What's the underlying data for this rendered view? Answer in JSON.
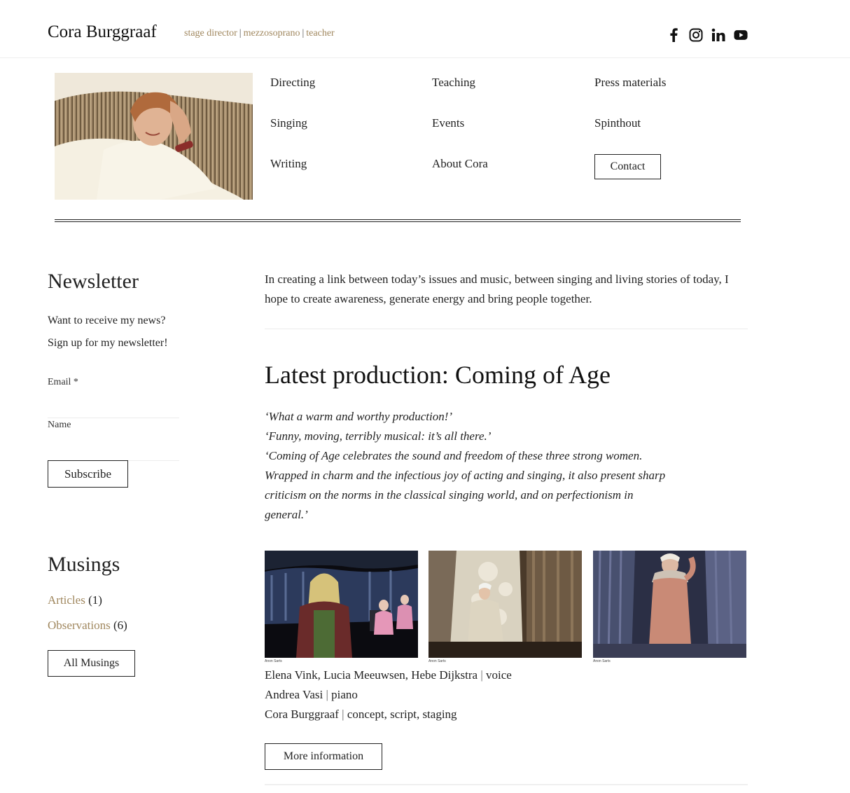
{
  "header": {
    "site_name": "Cora Burggraaf",
    "tagline": [
      "stage director",
      "mezzosoprano",
      "teacher"
    ],
    "tagline_sep": "|",
    "social_icons": [
      "facebook-icon",
      "instagram-icon",
      "linkedin-icon",
      "youtube-icon"
    ]
  },
  "nav": {
    "items": [
      "Directing",
      "Teaching",
      "Press materials",
      "Singing",
      "Events",
      "Spinthout",
      "Writing",
      "About Cora"
    ],
    "contact_label": "Contact"
  },
  "newsletter": {
    "title": "Newsletter",
    "line1": "Want to receive my news?",
    "line2": "Sign up for my newsletter!",
    "email_label": "Email *",
    "name_label": "Name",
    "subscribe_label": "Subscribe"
  },
  "musings": {
    "title": "Musings",
    "categories": [
      {
        "label": "Articles",
        "count": "(1)"
      },
      {
        "label": "Observations",
        "count": "(6)"
      }
    ],
    "all_label": "All Musings"
  },
  "main": {
    "intro": "In creating a link between today’s issues and music, between singing and living stories of today, I hope to create awareness, generate energy and bring people together.",
    "production_title": "Latest production: Coming of Age",
    "quotes": [
      "‘What a warm and worthy production!’",
      "‘Funny, moving, terribly musical: it’s all there.’",
      "‘Coming of Age celebrates the sound and freedom of these three strong women.",
      "Wrapped in charm and the infectious joy of acting and singing, it also present sharp",
      "criticism on the norms in the classical singing world, and on perfectionism in",
      "general.’"
    ],
    "photo_credit": "Anon Sarts",
    "cast": [
      {
        "names": "Elena Vink, Lucia Meeuwsen, Hebe Dijkstra",
        "role": "voice"
      },
      {
        "names": "Andrea Vasi",
        "role": "piano"
      },
      {
        "names": "Cora Burggraaf",
        "role": "concept, script, staging"
      }
    ],
    "cast_sep": "|",
    "more_label": "More information"
  },
  "colors": {
    "accent": "#a0875e",
    "text": "#222222",
    "divider": "#ececec"
  }
}
